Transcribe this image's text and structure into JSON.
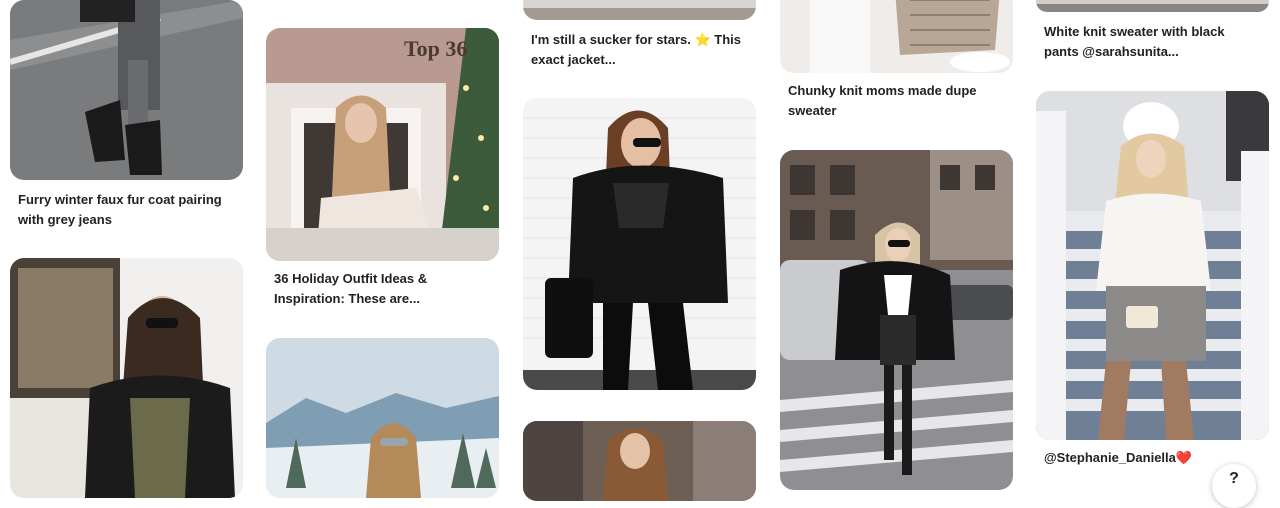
{
  "pins": {
    "c1p1": {
      "caption_line1": "Furry winter faux fur coat pairing",
      "caption_line2": "with grey jeans"
    },
    "c2p1": {
      "overlay_text": "Top 36",
      "caption_line1": "36 Holiday Outfit Ideas &",
      "caption_line2": "Inspiration: These are..."
    },
    "c3p1": {
      "caption_line1": "I'm still a sucker for stars. ⭐ This",
      "caption_line2": "exact jacket..."
    },
    "c4p1": {
      "caption_line1": "Chunky knit moms made dupe",
      "caption_line2": "sweater"
    },
    "c5p1": {
      "caption_line1": "White knit sweater with black",
      "caption_line2": "pants @sarahsunita..."
    },
    "c5p2": {
      "caption_line1": "@Stephanie_Daniella❤️"
    }
  },
  "help_button": {
    "label": "?"
  },
  "colors": {
    "caption_text": "#222222",
    "background": "#ffffff"
  }
}
